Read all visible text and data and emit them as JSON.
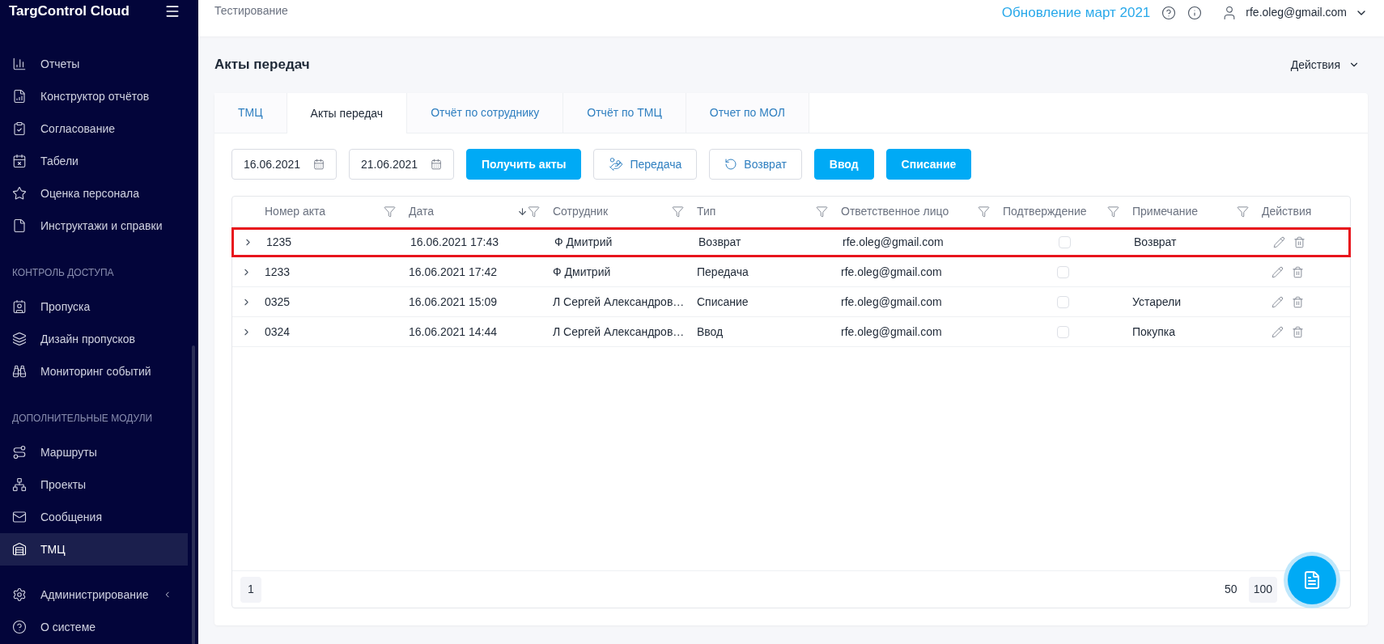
{
  "sidebar": {
    "logo": "TargControl Cloud",
    "groups": [
      {
        "items": [
          {
            "label": "Отчеты",
            "selected": false
          },
          {
            "label": "Конструктор отчётов",
            "selected": false
          },
          {
            "label": "Согласование",
            "selected": false
          },
          {
            "label": "Табели",
            "selected": false
          },
          {
            "label": "Оценка персонала",
            "selected": false
          },
          {
            "label": "Инструктажи и справки",
            "selected": false
          }
        ]
      },
      {
        "heading": "КОНТРОЛЬ ДОСТУПА",
        "items": [
          {
            "label": "Пропуска",
            "selected": false
          },
          {
            "label": "Дизайн пропусков",
            "selected": false
          },
          {
            "label": "Мониторинг событий",
            "selected": false
          }
        ]
      },
      {
        "heading": "ДОПОЛНИТЕЛЬНЫЕ МОДУЛИ",
        "items": [
          {
            "label": "Маршруты",
            "selected": false
          },
          {
            "label": "Проекты",
            "selected": false
          },
          {
            "label": "Сообщения",
            "selected": false
          },
          {
            "label": "ТМЦ",
            "selected": true
          }
        ]
      },
      {
        "items": [
          {
            "label": "Администрирование",
            "selected": false,
            "expanded": false
          },
          {
            "label": "О системе",
            "selected": false
          }
        ]
      }
    ]
  },
  "header": {
    "breadcrumb": "Тестирование",
    "update_link": "Обновление март 2021",
    "user": "rfe.oleg@gmail.com"
  },
  "page": {
    "title": "Акты передач",
    "actions_menu": "Действия"
  },
  "tabs": [
    {
      "label": "ТМЦ",
      "selected": false
    },
    {
      "label": "Акты передач",
      "selected": true
    },
    {
      "label": "Отчёт по сотруднику",
      "selected": false
    },
    {
      "label": "Отчёт по ТМЦ",
      "selected": false
    },
    {
      "label": "Отчет по МОЛ",
      "selected": false
    }
  ],
  "toolbar": {
    "date_from": "16.06.2021",
    "date_to": "21.06.2021",
    "buttons": [
      {
        "label": "Получить акты",
        "kind": "primary"
      },
      {
        "label": "Передача",
        "kind": "outline"
      },
      {
        "label": "Возврат",
        "kind": "outline"
      },
      {
        "label": "Ввод",
        "kind": "primary"
      },
      {
        "label": "Списание",
        "kind": "primary"
      }
    ]
  },
  "table": {
    "columns": [
      {
        "label": "Номер акта",
        "sorted": false
      },
      {
        "label": "Дата",
        "sorted": true
      },
      {
        "label": "Сотрудник",
        "sorted": false
      },
      {
        "label": "Тип",
        "sorted": false
      },
      {
        "label": "Ответственное лицо",
        "sorted": false
      },
      {
        "label": "Подтверждение",
        "sorted": false
      },
      {
        "label": "Примечание",
        "sorted": false
      },
      {
        "label": "Действия",
        "sorted": false,
        "kind": "actions"
      }
    ],
    "rows": [
      {
        "number": "1235",
        "date": "16.06.2021 17:43",
        "employee": "Ф Дмитрий",
        "type": "Возврат",
        "responsible": "rfe.oleg@gmail.com",
        "confirmed": false,
        "note": "Возврат",
        "highlighted": true
      },
      {
        "number": "1233",
        "date": "16.06.2021 17:42",
        "employee": "Ф Дмитрий",
        "type": "Передача",
        "responsible": "rfe.oleg@gmail.com",
        "confirmed": false,
        "highlighted": false
      },
      {
        "number": "0325",
        "date": "16.06.2021 15:09",
        "employee": "Л Сергей Александров…",
        "type": "Списание",
        "responsible": "rfe.oleg@gmail.com",
        "confirmed": false,
        "note": "Устарели",
        "highlighted": false
      },
      {
        "number": "0324",
        "date": "16.06.2021 14:44",
        "employee": "Л Сергей Александров…",
        "type": "Ввод",
        "responsible": "rfe.oleg@gmail.com",
        "confirmed": false,
        "note": "Покупка",
        "highlighted": false
      }
    ]
  },
  "pagination": {
    "pages": [
      {
        "label": "1",
        "selected": true
      }
    ],
    "page_sizes": [
      {
        "label": "50",
        "selected": false
      },
      {
        "label": "100",
        "selected": true
      }
    ]
  }
}
